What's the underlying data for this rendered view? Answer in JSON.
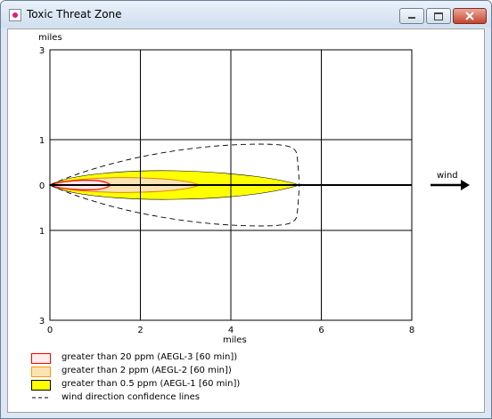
{
  "window": {
    "title": "Toxic Threat Zone"
  },
  "controls": {
    "minimize_icon": "minimize-icon",
    "maximize_icon": "maximize-icon",
    "close_icon": "close-icon"
  },
  "plot": {
    "y_unit": "miles",
    "x_unit": "miles",
    "y_ticks": [
      "3",
      "1",
      "0",
      "1",
      "3"
    ],
    "x_ticks": [
      "0",
      "2",
      "4",
      "6",
      "8"
    ],
    "wind_label": "wind",
    "x_range": [
      0,
      8
    ],
    "y_range": [
      -3,
      3
    ]
  },
  "legend": [
    {
      "label": "greater than 20 ppm (AEGL-3 [60 min])",
      "color": "#ff0000"
    },
    {
      "label": "greater than 2 ppm (AEGL-2 [60 min])",
      "color": "#ff9900"
    },
    {
      "label": "greater than 0.5 ppm (AEGL-1 [60 min])",
      "color": "#ffff00"
    },
    {
      "label": "wind direction confidence lines",
      "color": "#000000"
    }
  ]
}
